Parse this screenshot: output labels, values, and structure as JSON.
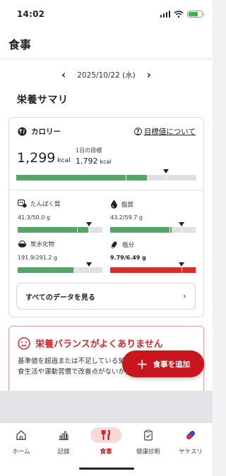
{
  "status": {
    "time": "14:02"
  },
  "header": {
    "title": "食事"
  },
  "date": {
    "label": "2025/10/22 (水)"
  },
  "summary": {
    "title": "栄養サマリ",
    "calorie": {
      "label": "カロリー",
      "help_link": "目標値について",
      "value": "1,299",
      "unit": "kcal",
      "goal_label": "1日の目標",
      "goal_value": "1,792",
      "goal_unit": "kcal",
      "progress": 0.725
    },
    "nutrients": [
      {
        "name": "たんぱく質",
        "icon": "protein-icon",
        "value": "41.3/50.0 g",
        "progress": 0.83,
        "status": "ok"
      },
      {
        "name": "脂質",
        "icon": "drop-icon",
        "value": "43.2/59.7 g",
        "progress": 0.72,
        "status": "ok"
      },
      {
        "name": "炭水化物",
        "icon": "rice-bowl-icon",
        "value": "191.9/291.2 g",
        "progress": 0.66,
        "status": "ok"
      },
      {
        "name": "塩分",
        "icon": "salt-shaker-icon",
        "value": "9.79/6.49 g",
        "progress": 1.0,
        "status": "over"
      }
    ],
    "see_all": "すべてのデータを見る"
  },
  "alert": {
    "title": "栄養バランスがよくありません",
    "body": "基準値を超過または不足している栄養素があります。日々の食生活や運動習慣で改善点がないか振り返って"
  },
  "fab": {
    "label": "食事を追加"
  },
  "tabs": [
    {
      "label": "ホーム",
      "icon": "home-icon",
      "active": false
    },
    {
      "label": "記録",
      "icon": "chart-icon",
      "active": false
    },
    {
      "label": "食事",
      "icon": "fork-knife-icon",
      "active": true
    },
    {
      "label": "健康診断",
      "icon": "clipboard-icon",
      "active": false
    },
    {
      "label": "ヤケスリ",
      "icon": "pill-icon",
      "active": false
    }
  ],
  "colors": {
    "accent": "#c8161e",
    "good": "#55a468",
    "bad": "#e02a2a"
  }
}
